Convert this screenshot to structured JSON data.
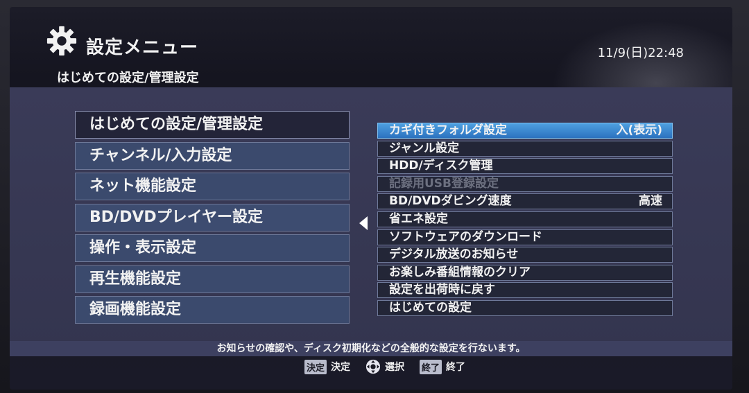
{
  "header": {
    "title": "設定メニュー",
    "breadcrumb": "はじめての設定/管理設定",
    "clock": "11/9(日)22:48"
  },
  "left_menu": [
    {
      "label": "はじめての設定/管理設定",
      "selected": true
    },
    {
      "label": "チャンネル/入力設定"
    },
    {
      "label": "ネット機能設定"
    },
    {
      "label": "BD/DVDプレイヤー設定"
    },
    {
      "label": "操作・表示設定"
    },
    {
      "label": "再生機能設定"
    },
    {
      "label": "録画機能設定"
    }
  ],
  "right_menu": [
    {
      "label": "カギ付きフォルダ設定",
      "value": "入(表示)",
      "active": true
    },
    {
      "label": "ジャンル設定"
    },
    {
      "label": "HDD/ディスク管理"
    },
    {
      "label": "記録用USB登録設定",
      "disabled": true
    },
    {
      "label": "BD/DVDダビング速度",
      "value": "高速"
    },
    {
      "label": "省エネ設定"
    },
    {
      "label": "ソフトウェアのダウンロード"
    },
    {
      "label": "デジタル放送のお知らせ"
    },
    {
      "label": "お楽しみ番組情報のクリア"
    },
    {
      "label": "設定を出荷時に戻す"
    },
    {
      "label": "はじめての設定"
    }
  ],
  "info_text": "お知らせの確認や、ディスク初期化などの全般的な設定を行ないます。",
  "footer": {
    "ok_key": "決定",
    "ok_label": "決定",
    "select_label": "選択",
    "exit_key": "終了",
    "exit_label": "終了"
  },
  "icons": {
    "gear": "gear-icon",
    "left_arrow": "triangle-left-icon",
    "dpad": "dpad-icon"
  },
  "colors": {
    "active_item": "#3a8ad6",
    "panel": "#383a55"
  }
}
